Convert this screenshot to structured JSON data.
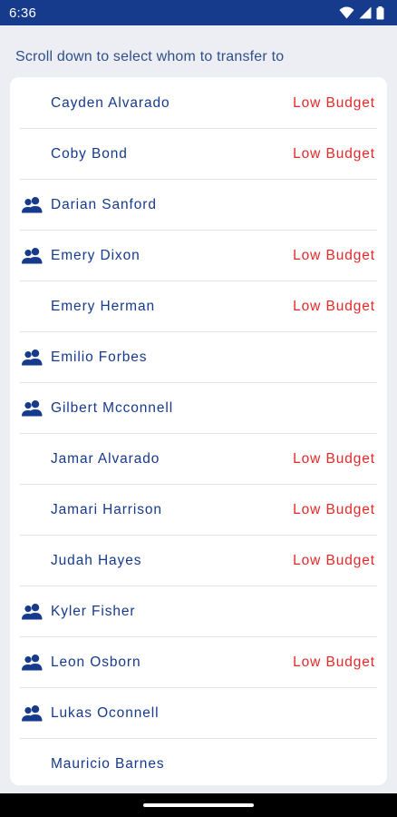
{
  "status_bar": {
    "time": "6:36",
    "icons": [
      "wifi-icon",
      "signal-icon",
      "battery-icon"
    ]
  },
  "instruction": "Scroll down to select whom to transfer to",
  "colors": {
    "primary": "#163a8c",
    "warning": "#e62828",
    "background": "#eceef4",
    "card": "#ffffff"
  },
  "people": [
    {
      "name": "Cayden Alvarado",
      "group": false,
      "badge": "Low Budget"
    },
    {
      "name": "Coby Bond",
      "group": false,
      "badge": "Low Budget"
    },
    {
      "name": "Darian Sanford",
      "group": true,
      "badge": ""
    },
    {
      "name": "Emery Dixon",
      "group": true,
      "badge": "Low Budget"
    },
    {
      "name": "Emery Herman",
      "group": false,
      "badge": "Low Budget"
    },
    {
      "name": "Emilio Forbes",
      "group": true,
      "badge": ""
    },
    {
      "name": "Gilbert Mcconnell",
      "group": true,
      "badge": ""
    },
    {
      "name": "Jamar Alvarado",
      "group": false,
      "badge": "Low Budget"
    },
    {
      "name": "Jamari Harrison",
      "group": false,
      "badge": "Low Budget"
    },
    {
      "name": "Judah Hayes",
      "group": false,
      "badge": "Low Budget"
    },
    {
      "name": "Kyler Fisher",
      "group": true,
      "badge": ""
    },
    {
      "name": "Leon Osborn",
      "group": true,
      "badge": "Low Budget"
    },
    {
      "name": "Lukas Oconnell",
      "group": true,
      "badge": ""
    },
    {
      "name": "Mauricio Barnes",
      "group": false,
      "badge": ""
    }
  ]
}
